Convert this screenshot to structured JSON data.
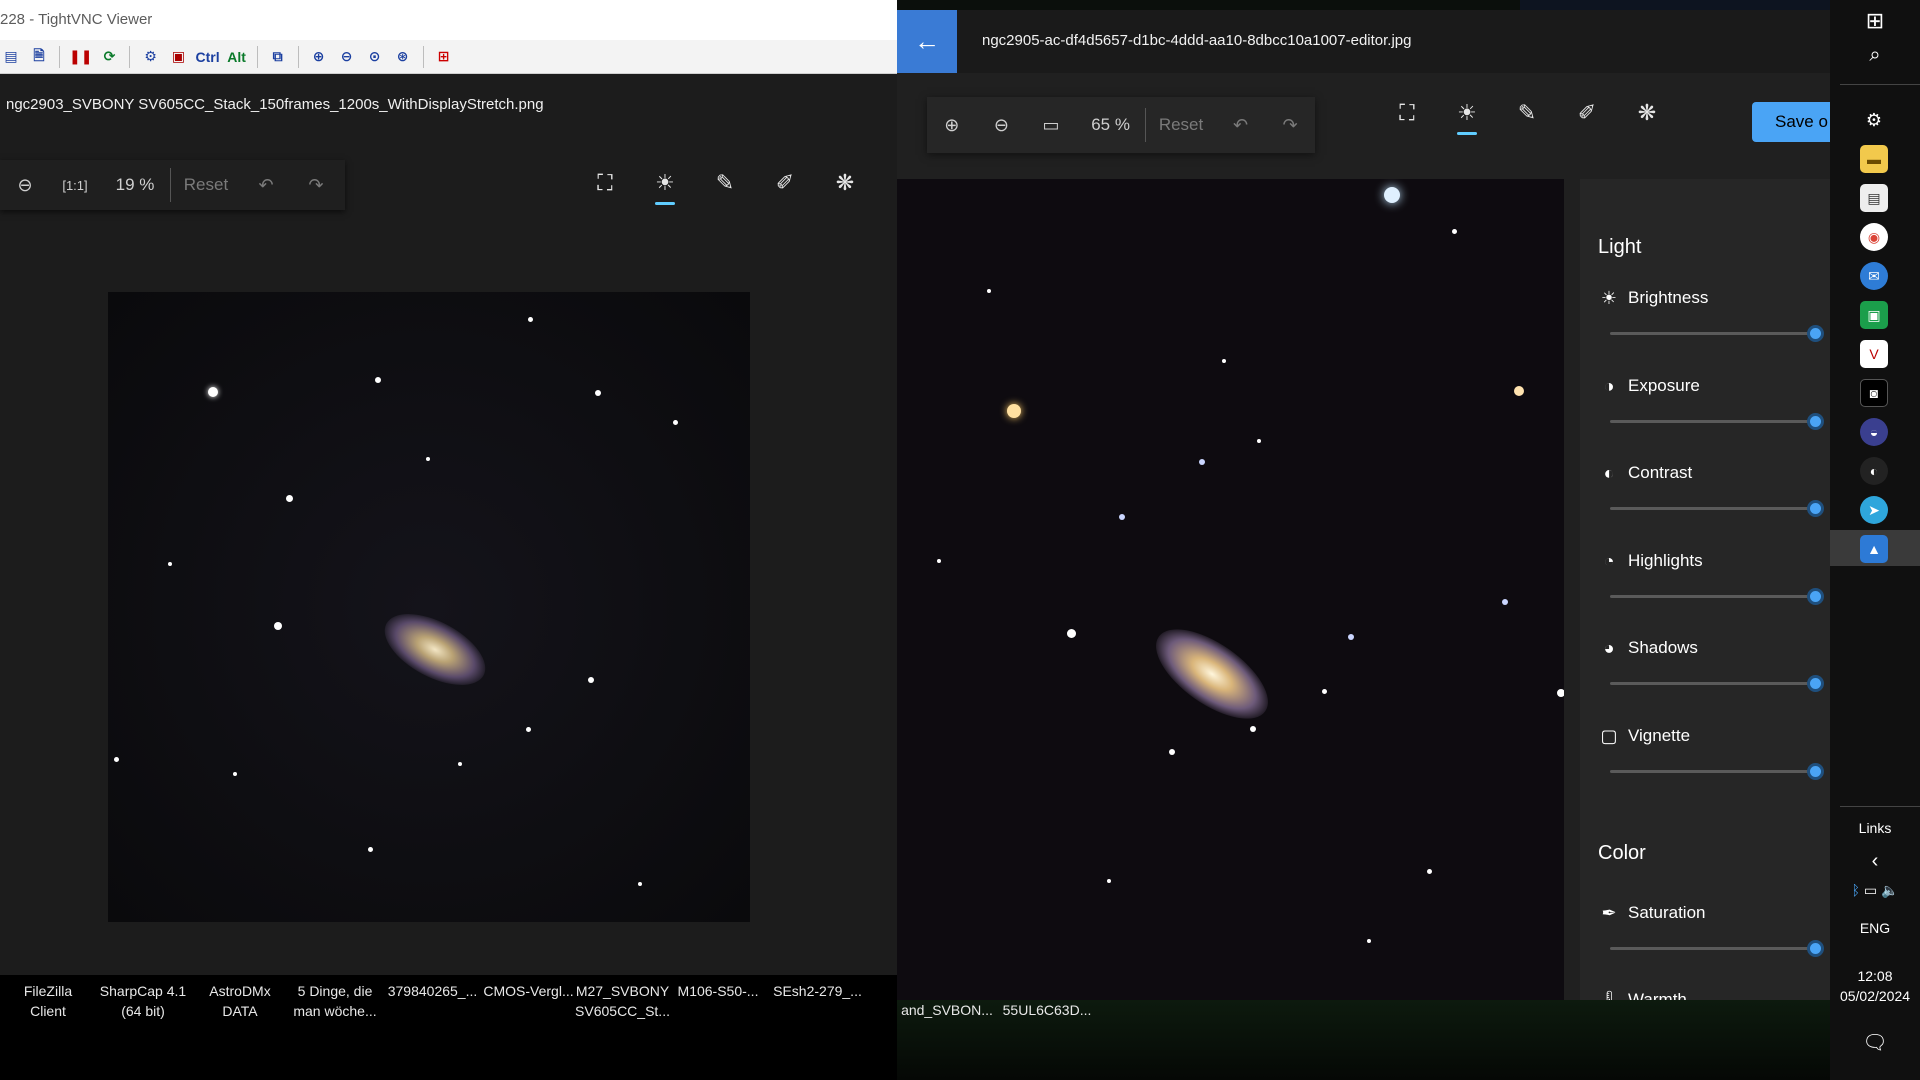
{
  "vnc": {
    "title": "228 - TightVNC Viewer",
    "toolbar_items": [
      "Ctrl",
      "Alt"
    ],
    "filename": "ngc2903_SVBONY SV605CC_Stack_150frames_1200s_WithDisplayStretch.png",
    "zoom": "19 %",
    "reset_label": "Reset",
    "taskbar": [
      {
        "line1": "FileZilla",
        "line2": "Client"
      },
      {
        "line1": "SharpCap 4.1",
        "line2": "(64 bit)"
      },
      {
        "line1": "AstroDMx",
        "line2": "DATA"
      },
      {
        "line1": "5 Dinge, die",
        "line2": "man wöche..."
      },
      {
        "line1": "379840265_...",
        "line2": ""
      },
      {
        "line1": "CMOS-Vergl...",
        "line2": ""
      },
      {
        "line1": "M27_SVBONY",
        "line2": "SV605CC_St..."
      },
      {
        "line1": "M106-S50-...",
        "line2": ""
      },
      {
        "line1": "SEsh2-279_...",
        "line2": ""
      },
      {
        "line1": "",
        "line2": "and_SVBON..."
      },
      {
        "line1": "",
        "line2": "55UL6C63D..."
      }
    ]
  },
  "editor": {
    "title": "ngc2905-ac-df4d5657-d1bc-4ddd-aa10-8dbcc10a1007-editor.jpg",
    "zoom": "65 %",
    "reset_label": "Reset",
    "save_label": "Save o",
    "panel": {
      "light_heading": "Light",
      "color_heading": "Color",
      "adjustments": [
        {
          "label": "Brightness",
          "icon": "brightness-icon",
          "value": 1.0
        },
        {
          "label": "Exposure",
          "icon": "exposure-icon",
          "value": 1.0
        },
        {
          "label": "Contrast",
          "icon": "contrast-icon",
          "value": 1.0
        },
        {
          "label": "Highlights",
          "icon": "highlights-icon",
          "value": 1.0
        },
        {
          "label": "Shadows",
          "icon": "shadows-icon",
          "value": 1.0
        },
        {
          "label": "Vignette",
          "icon": "vignette-icon",
          "value": 1.0
        }
      ],
      "color_adjustments": [
        {
          "label": "Saturation",
          "icon": "saturation-icon",
          "value": 1.0
        },
        {
          "label": "Warmth",
          "icon": "warmth-icon",
          "value": null
        }
      ]
    }
  },
  "system": {
    "links_label": "Links",
    "language": "ENG",
    "time": "12:08",
    "date": "05/02/2024"
  },
  "colors": {
    "accent": "#4aa4f5",
    "back_button": "#3a7bd5"
  }
}
